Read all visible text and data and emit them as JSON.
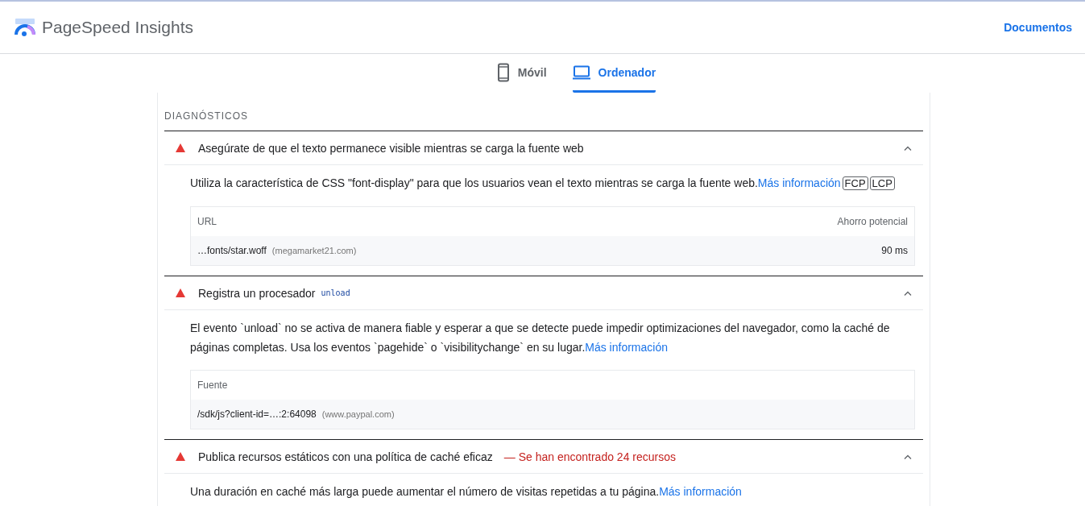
{
  "header": {
    "title": "PageSpeed Insights",
    "docs_link": "Documentos"
  },
  "tabs": [
    {
      "label": "Móvil",
      "kind": "phone",
      "selected": false
    },
    {
      "label": "Ordenador",
      "kind": "laptop",
      "selected": true
    }
  ],
  "section": {
    "title": "DIAGNÓSTICOS"
  },
  "audits": [
    {
      "title": "Asegúrate de que el texto permanece visible mientras se carga la fuente web",
      "expanded": true,
      "description": "Utiliza la característica de CSS \"font-display\" para que los usuarios vean el texto mientras se carga la fuente web.",
      "link": "Más información",
      "badges": [
        "FCP",
        "LCP"
      ],
      "table": {
        "columns": [
          "URL",
          "Ahorro potencial"
        ],
        "rows": [
          {
            "url": "…fonts/star.woff",
            "host": "(megamarket21.com)",
            "value": "90 ms"
          }
        ]
      }
    },
    {
      "title": "Registra un procesador",
      "title_code": "unload",
      "expanded": true,
      "description": "El evento `unload` no se activa de manera fiable y esperar a que se detecte puede impedir optimizaciones del navegador, como la caché de páginas completas. Usa los eventos `pagehide` o `visibilitychange` en su lugar.",
      "link": "Más información",
      "table": {
        "columns": [
          "Fuente"
        ],
        "rows": [
          {
            "url": "/sdk/js?client-id=…:2:64098",
            "host": "(www.paypal.com)"
          }
        ]
      }
    },
    {
      "title": "Publica recursos estáticos con una política de caché eficaz",
      "warning": "— Se han encontrado 24 recursos",
      "expanded": true,
      "description": "Una duración en caché más larga puede aumentar el número de visitas repetidas a tu página.",
      "link": "Más información"
    }
  ]
}
